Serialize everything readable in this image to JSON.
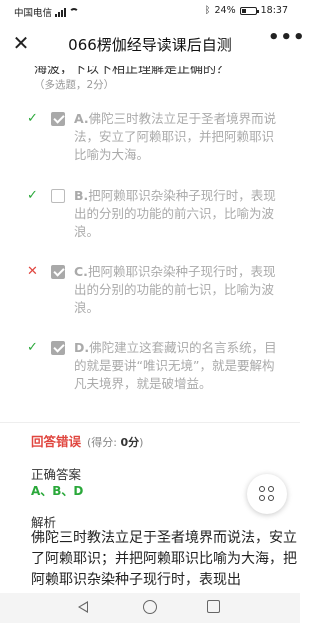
{
  "status_bar": {
    "carrier": "中国电信",
    "network": "4G",
    "battery_percent": "24%",
    "time": "18:37"
  },
  "nav": {
    "close_icon": "close-icon",
    "title": "066楞伽经导读课后自测",
    "more_icon": "more-icon",
    "more_label": "•••"
  },
  "question": {
    "stem_partial": "海波，下以下相正理解是正确的？",
    "type_label": "（多选题，2分）",
    "options": [
      {
        "letter": "A.",
        "text": "佛陀三时教法立足于圣者境界而说法，安立了阿赖耶识，并把阿赖耶识比喻为大海。",
        "checked": true,
        "mark": "✓",
        "mark_type": "correct"
      },
      {
        "letter": "B.",
        "text": "把阿赖耶识杂染种子现行时，表现出的分别的功能的前六识，比喻为波浪。",
        "checked": false,
        "mark": "✓",
        "mark_type": "correct"
      },
      {
        "letter": "C.",
        "text": "把阿赖耶识杂染种子现行时，表现出的分别的功能的前七识，比喻为波浪。",
        "checked": true,
        "mark": "✕",
        "mark_type": "wrong"
      },
      {
        "letter": "D.",
        "text": "佛陀建立这套藏识的名言系统，目的就是要讲“唯识无境”，就是要解构凡夫境界，就是破增益。",
        "checked": true,
        "mark": "✓",
        "mark_type": "correct"
      }
    ]
  },
  "result": {
    "status": "回答错误",
    "score_prefix": "(得分: ",
    "score": "0分",
    "score_suffix": ")"
  },
  "answer": {
    "label": "正确答案",
    "value": "A、B、D"
  },
  "explanation": {
    "label": "解析",
    "text": "佛陀三时教法立足于圣者境界而说法，安立了阿赖耶识；并把阿赖耶识比喻为大海，把阿赖耶识杂染种子现行时，表现出"
  },
  "colors": {
    "correct": "#2aa83a",
    "wrong": "#e0463f",
    "muted": "#aaaaaa"
  }
}
